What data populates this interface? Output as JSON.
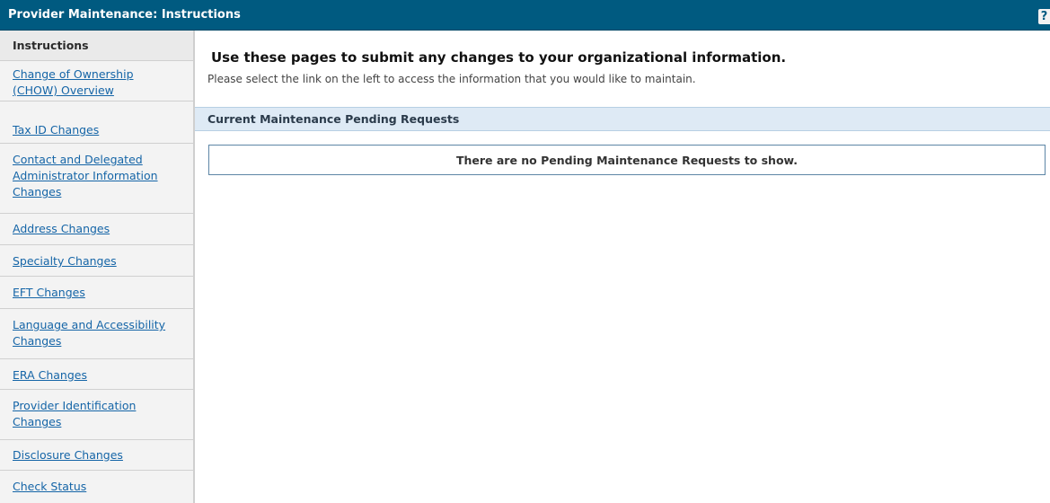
{
  "header": {
    "title": "Provider Maintenance: Instructions",
    "help_label": "?"
  },
  "sidebar": {
    "items": [
      {
        "label": "Instructions"
      },
      {
        "label": "Change of Ownership (CHOW) Overview"
      },
      {
        "label": "Tax ID Changes"
      },
      {
        "label": "Contact and Delegated Administrator Information Changes"
      },
      {
        "label": "Address Changes"
      },
      {
        "label": "Specialty Changes"
      },
      {
        "label": "EFT Changes"
      },
      {
        "label": "Language and Accessibility Changes"
      },
      {
        "label": "ERA Changes"
      },
      {
        "label": "Provider Identification Changes"
      },
      {
        "label": "Disclosure Changes"
      },
      {
        "label": "Check Status"
      }
    ]
  },
  "main": {
    "headline": "Use these pages to submit any changes to your organizational information.",
    "subtext": "Please select the link on the left to access the information that you would like to maintain.",
    "pending_section_title": "Current Maintenance Pending Requests",
    "empty_message": "There are no Pending Maintenance Requests to show."
  }
}
